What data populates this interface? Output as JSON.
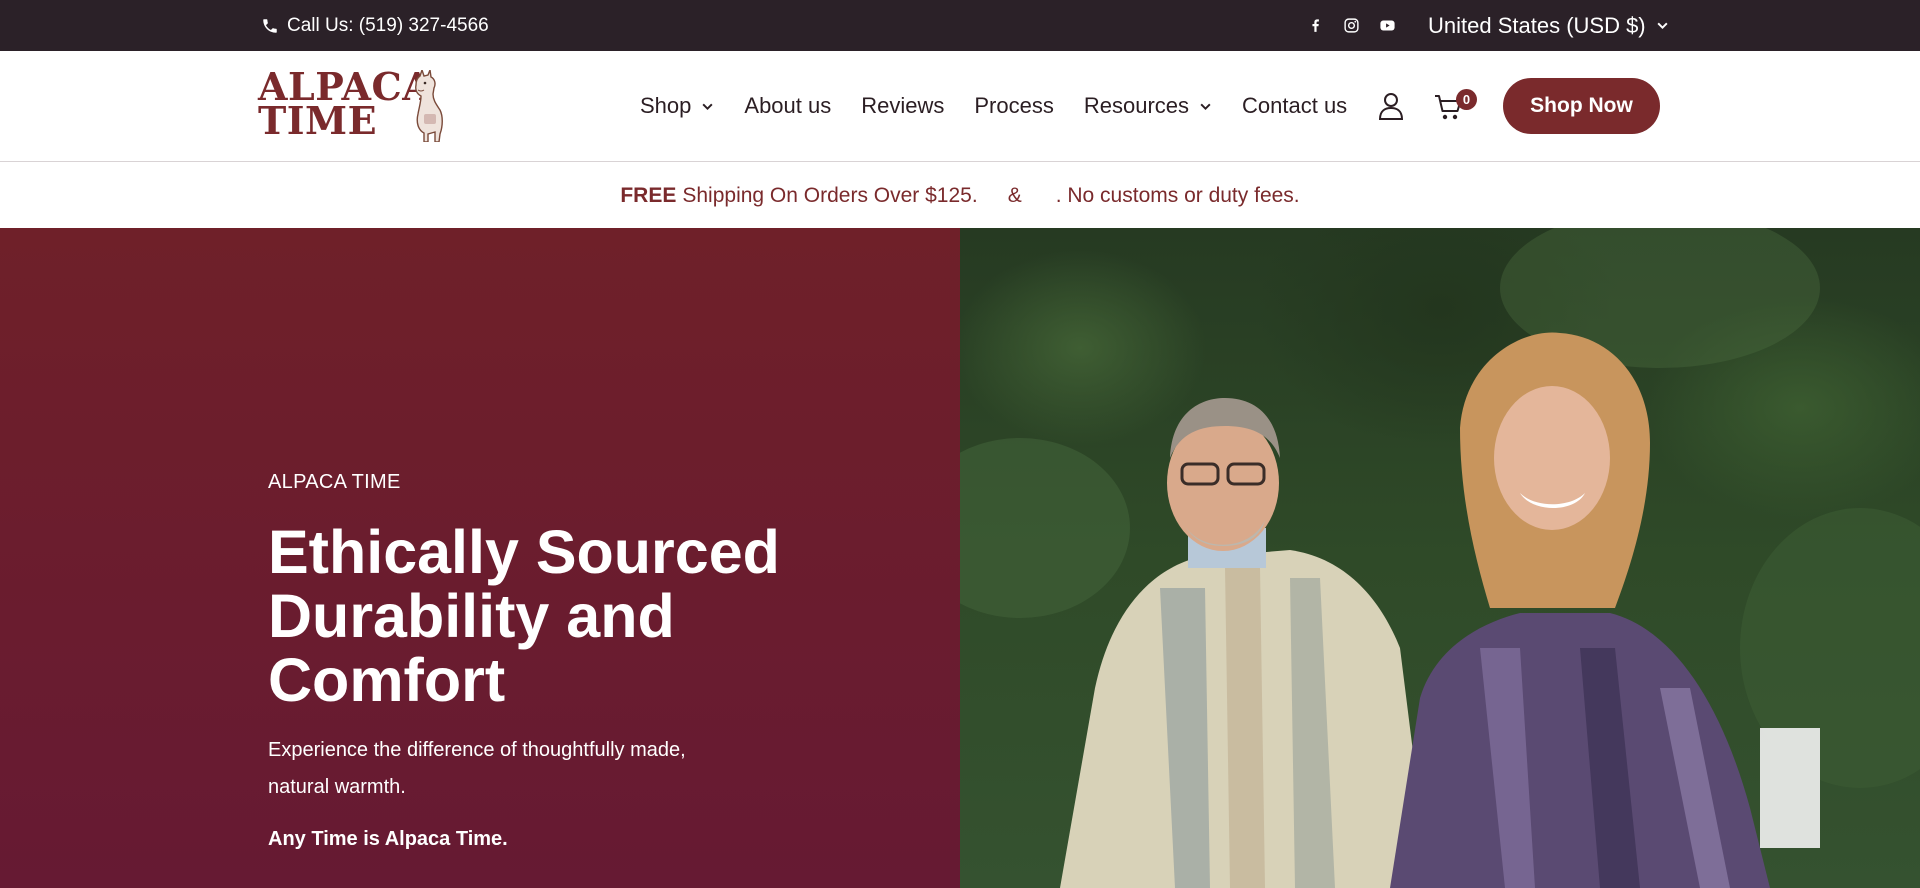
{
  "topbar": {
    "call_label": "Call Us: (519) 327-4566",
    "social_icons": [
      "facebook-icon",
      "instagram-icon",
      "youtube-icon"
    ],
    "country_selector": "United States (USD $)"
  },
  "header": {
    "logo_text_line1": "ALPACA",
    "logo_text_line2": "TIME",
    "nav": [
      {
        "label": "Shop"
      },
      {
        "label": "About us"
      },
      {
        "label": "Reviews"
      },
      {
        "label": "Process"
      },
      {
        "label": "Resources"
      },
      {
        "label": "Contact us"
      }
    ],
    "cart_count": "0",
    "shop_now_label": "Shop Now"
  },
  "announcement": {
    "free": "FREE",
    "shipping": "Shipping On Orders Over $125.",
    "amp": "&",
    "customs": ". No customs or duty fees."
  },
  "hero": {
    "eyebrow": "ALPACA TIME",
    "heading": "Ethically Sourced Durability and Comfort",
    "subtext": "Experience the difference of thoughtfully made, natural warmth.",
    "tagline": "Any Time is Alpaca Time."
  },
  "colors": {
    "brand": "#7a2a2c",
    "topbar_bg": "#2b2128",
    "hero_bg": "#6a1c2f"
  }
}
